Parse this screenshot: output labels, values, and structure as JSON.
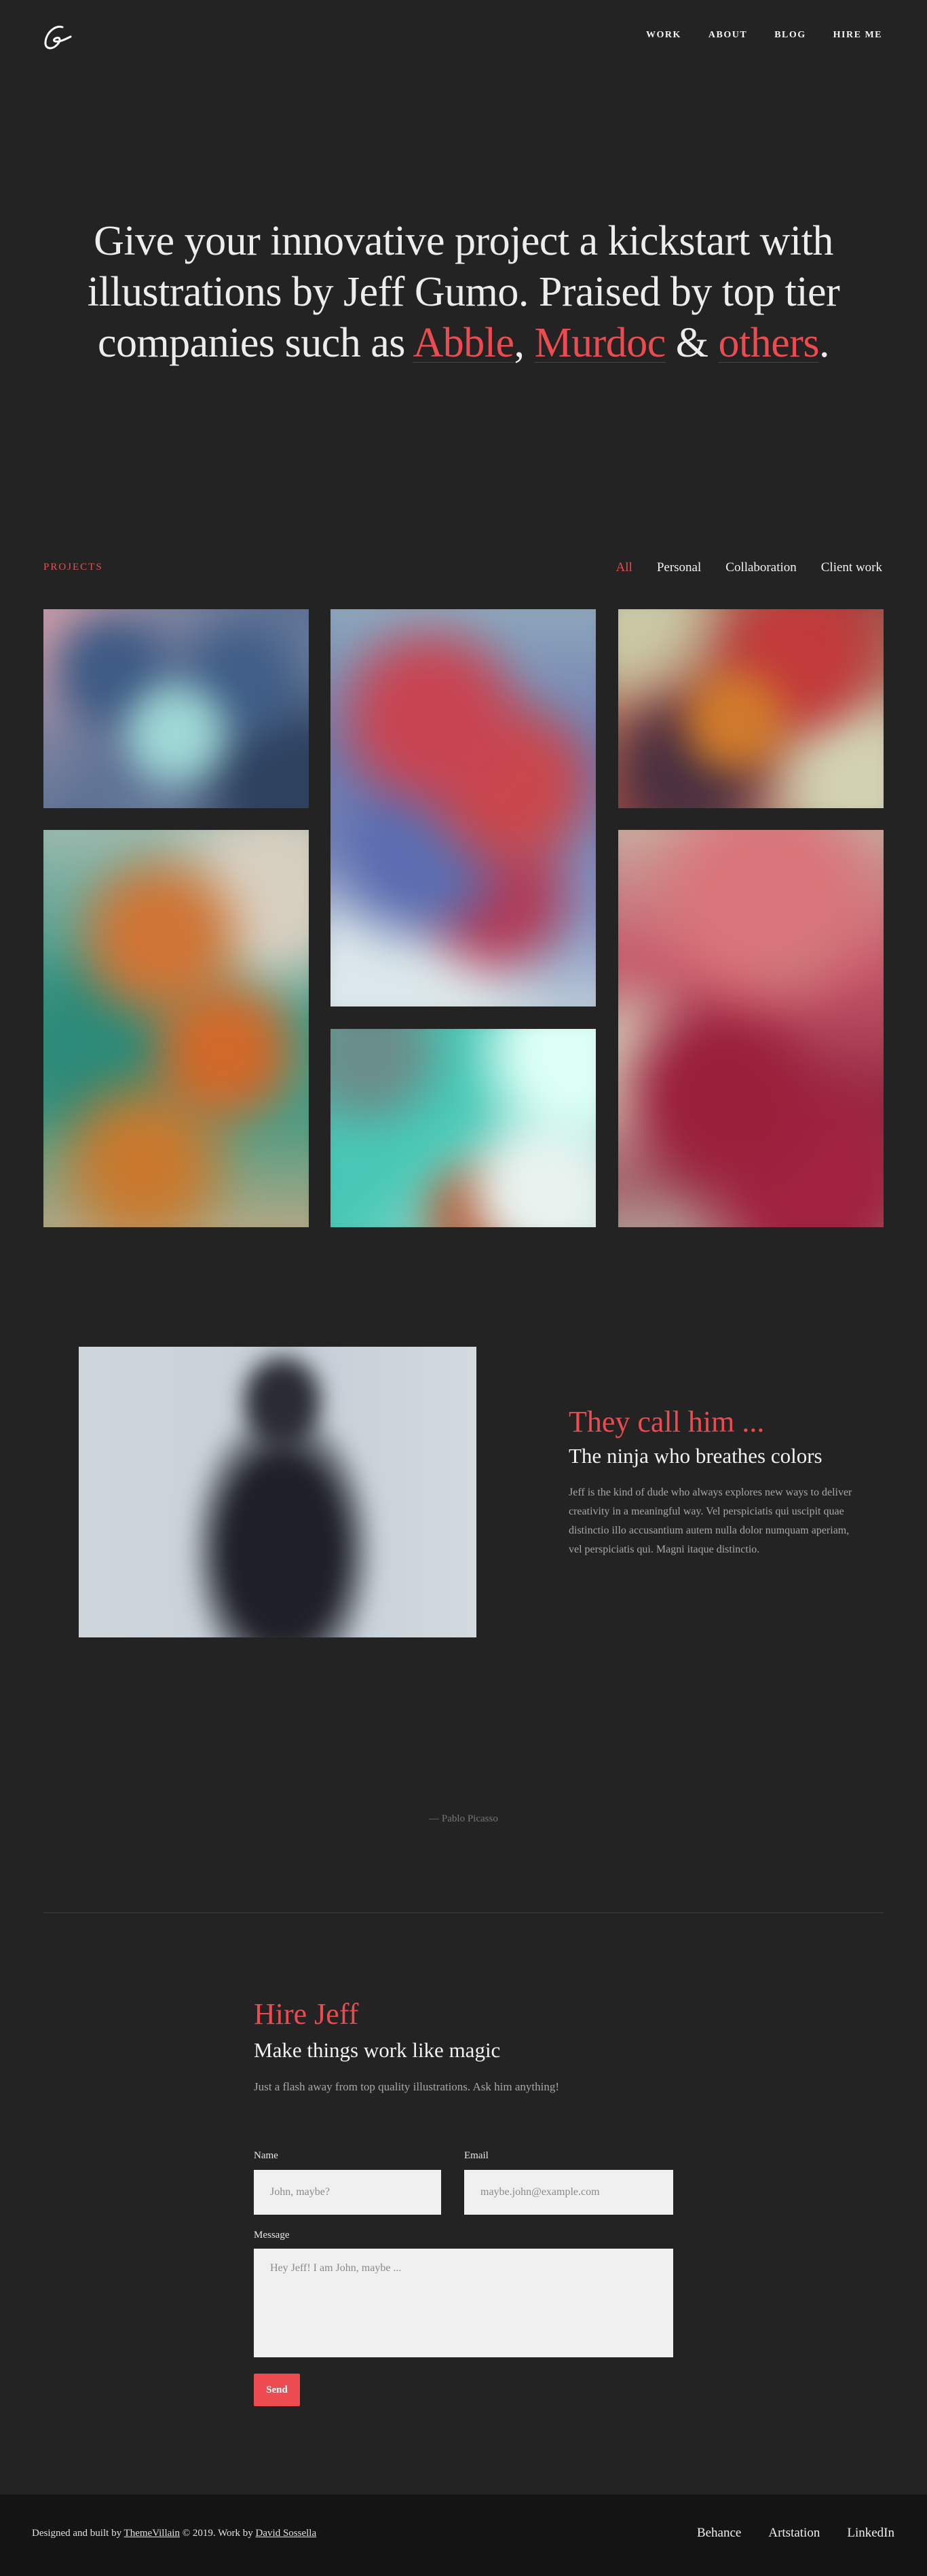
{
  "header": {
    "logo_icon": "signature-g-logo-icon",
    "nav": [
      "WORK",
      "ABOUT",
      "BLOG",
      "HIRE ME"
    ]
  },
  "hero": {
    "line1": "Give your innovative project a kickstart with",
    "line2": "illustrations by Jeff Gumo. Praised by top tier",
    "line3_start": "companies such as ",
    "company1": "Abble",
    "sep1": ", ",
    "company2": "Murdoc",
    "sep2": " & ",
    "company3": "others",
    "end": "."
  },
  "projects": {
    "label": "PROJECTS",
    "filters": [
      "All",
      "Personal",
      "Collaboration",
      "Client work"
    ],
    "active_filter": "All"
  },
  "about": {
    "heading": "They call him ...",
    "subheading": "The ninja who breathes colors",
    "paragraph": "Jeff is the kind of dude who always explores new ways to deliver creativity in a meaningful way. Vel perspiciatis qui uscipit quae distinctio illo accusantium autem nulla dolor numquam aperiam, vel perspiciatis qui. Magni itaque distinctio."
  },
  "quote": {
    "attribution": "— Pablo Picasso"
  },
  "hire": {
    "heading": "Hire Jeff",
    "subheading": "Make things work like magic",
    "text": "Just a flash away from top quality illustrations. Ask him anything!",
    "name_label": "Name",
    "name_placeholder": "John, maybe?",
    "email_label": "Email",
    "email_placeholder": "maybe.john@example.com",
    "message_label": "Message",
    "message_placeholder": "Hey Jeff! I am John, maybe ...",
    "send_label": "Send"
  },
  "footer": {
    "credits_prefix": "Designed and built by ",
    "credits_author1": "ThemeVillain",
    "credits_middle": " © 2019. Work by ",
    "credits_author2": "David Sossella",
    "social": [
      "Behance",
      "Artstation",
      "LinkedIn"
    ]
  },
  "colors": {
    "accent": "#ec4b4f",
    "background": "#232323",
    "footer": "#141414"
  }
}
